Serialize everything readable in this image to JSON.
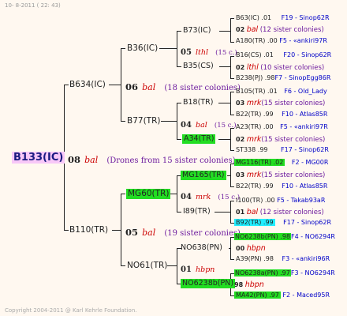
{
  "header": "10-  8-2011 ( 22: 43)",
  "footer": "Copyright 2004-2011 @ Karl Kehrle Foundation.",
  "root": {
    "label": "B133(IC)"
  },
  "gen1": [
    {
      "label": "B634(IC)"
    },
    {
      "year": "08",
      "name": "bal",
      "note": "(Drones from 15 sister colonies)"
    },
    {
      "label": "B110(TR)"
    }
  ],
  "gen2": [
    {
      "label": "B36(IC)"
    },
    {
      "year": "06",
      "name": "bal",
      "note": "(18 sister colonies)"
    },
    {
      "label": "B77(TR)"
    },
    {
      "label": "MG60(TR)"
    },
    {
      "year": "05",
      "name": "bal",
      "note": "(19 sister colonies)"
    },
    {
      "label": "NO61(TR)"
    }
  ],
  "gen3": [
    {
      "label": "B73(IC)"
    },
    {
      "year": "05",
      "name": "lthl",
      "note": "(15 c.)"
    },
    {
      "label": "B35(CS)"
    },
    {
      "label": "B18(TR)"
    },
    {
      "year": "04",
      "name": "bal",
      "note": "(15 c.)"
    },
    {
      "label": "A34(TR)"
    },
    {
      "label": "MG165(TR)"
    },
    {
      "year": "04",
      "name": "mrk",
      "note": "(15 c.)"
    },
    {
      "label": "I89(TR)"
    },
    {
      "label": "NO638(PN)"
    },
    {
      "year": "00",
      "name": "hbpn",
      "note": ""
    },
    {
      "label": "A39(PN) .98"
    },
    {
      "label": "NO638b(PN)"
    },
    {
      "year": "01",
      "name": "hbpn",
      "note": ""
    },
    {
      "label": "NO6238b(PN)"
    }
  ],
  "gen4": [
    {
      "label": "B63(IC) .01",
      "src": "F19 - Sinop62R"
    },
    {
      "year": "02",
      "name": "bal",
      "note": "(12 sister colonies)"
    },
    {
      "label": "A180(TR) .00",
      "src": "F5 - «ankiri97R"
    },
    {
      "label": "B16(CS) .01",
      "src": "F20 - Sinop62R"
    },
    {
      "year": "02",
      "name": "lthl",
      "note": "(10 sister colonies)"
    },
    {
      "label": "B238(PJ) .98",
      "src": "F7 - SinopEgg86R"
    },
    {
      "label": "B105(TR) .01",
      "src": "F6 - Old_Lady"
    },
    {
      "year": "03",
      "name": "mrk",
      "note": "(15 sister colonies)"
    },
    {
      "label": "B22(TR) .99",
      "src": "F10 - Atlas85R"
    },
    {
      "label": "A23(TR) .00",
      "src": "F5 - «ankiri97R"
    },
    {
      "year": "02",
      "name": "mrk",
      "note": "(15 sister colonies)"
    },
    {
      "label": "ST338 .99",
      "src": "F17 - Sinop62R"
    },
    {
      "label": "MG116(TR) .02",
      "src": "F2 - MG00R"
    },
    {
      "year": "03",
      "name": "mrk",
      "note": "(15 sister colonies)"
    },
    {
      "label": "B22(TR) .99",
      "src": "F10 - Atlas85R"
    },
    {
      "label": "I100(TR) .00",
      "src": "F5 - Takab93aR"
    },
    {
      "year": "01",
      "name": "bal",
      "note": "(12 sister colonies)"
    },
    {
      "label": "B92(TR) .99",
      "src": "F17 - Sinop62R"
    },
    {
      "label": "NO6238b(PN) .98",
      "src": "F4 - NO6294R"
    },
    {
      "year": "00",
      "name": "hbpn",
      "note": ""
    },
    {
      "label": "A39(PN) .98",
      "src": "F3 - «ankiri96R"
    },
    {
      "label": "NO6238a(PN) .97",
      "src": "F3 - NO6294R"
    },
    {
      "year": "98",
      "name": "hbpn",
      "note": ""
    },
    {
      "label": "MA42(PN) .97",
      "src": "F2 - Maced95R"
    }
  ]
}
